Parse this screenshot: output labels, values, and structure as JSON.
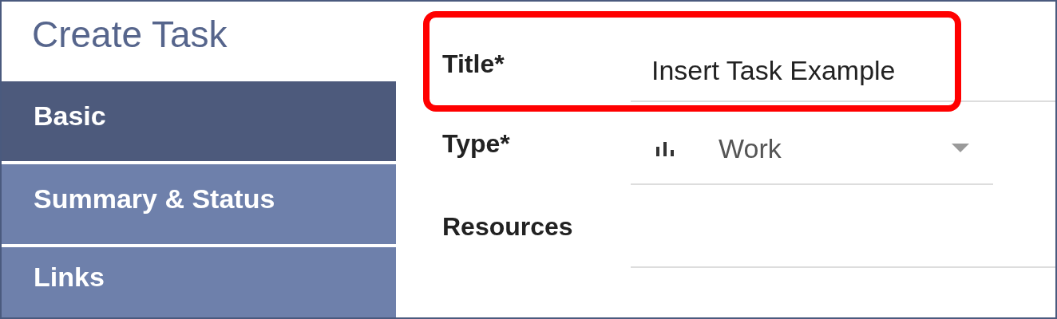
{
  "heading": "Create Task",
  "nav": [
    {
      "label": "Basic",
      "selected": true
    },
    {
      "label": "Summary & Status",
      "selected": false
    },
    {
      "label": "Links",
      "selected": false
    }
  ],
  "fields": [
    {
      "kind": "text",
      "label": "Title*",
      "value": "Insert Task Example",
      "highlighted": true
    },
    {
      "kind": "select",
      "label": "Type*",
      "value": "Work",
      "highlighted": false
    },
    {
      "kind": "text",
      "label": "Resources",
      "highlighted": false
    }
  ]
}
